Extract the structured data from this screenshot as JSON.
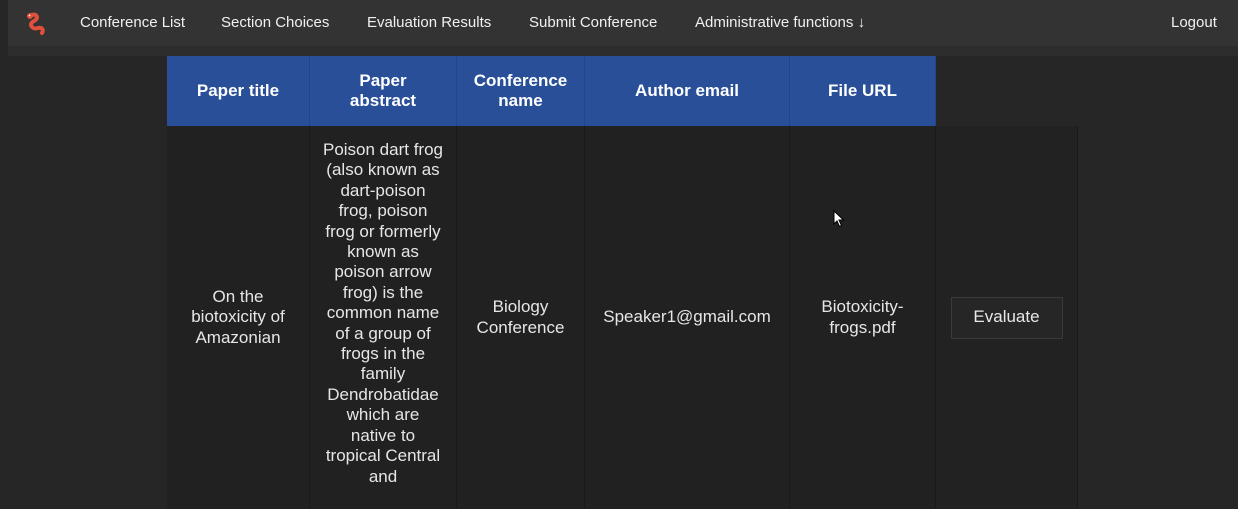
{
  "nav": {
    "links": [
      {
        "label": "Conference List"
      },
      {
        "label": "Section Choices"
      },
      {
        "label": "Evaluation Results"
      },
      {
        "label": "Submit Conference"
      },
      {
        "label": "Administrative functions ↓"
      }
    ],
    "logout_label": "Logout",
    "logo_icon": "worm-logo-icon"
  },
  "table": {
    "headers": [
      "Paper title",
      "Paper abstract",
      "Conference name",
      "Author email",
      "File URL"
    ],
    "rows": [
      {
        "title": "On the biotoxicity of Amazonian",
        "abstract": "Poison dart frog (also known as dart-poison frog, poison frog or formerly known as poison arrow frog) is the common name of a group of frogs in the family Dendrobatidae which are native to tropical Central and",
        "conference": "Biology Conference",
        "email": "Speaker1@gmail.com",
        "file": "Biotoxicity-frogs.pdf",
        "action_label": "Evaluate"
      }
    ]
  },
  "colors": {
    "header_bg": "#2a4f99",
    "navbar_bg": "#333333",
    "page_bg": "#262626"
  }
}
